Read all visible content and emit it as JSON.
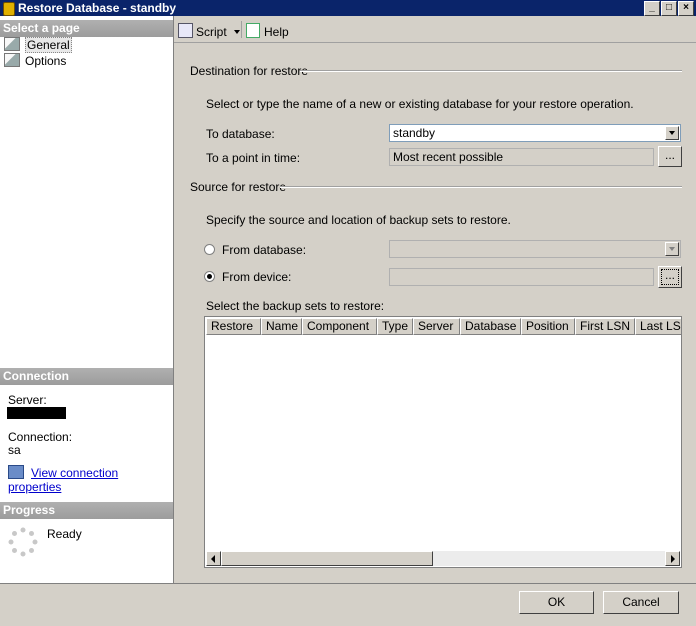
{
  "window": {
    "title": "Restore Database - standby"
  },
  "left": {
    "select_header": "Select a page",
    "pages": [
      {
        "label": "General"
      },
      {
        "label": "Options"
      }
    ],
    "connection_header": "Connection",
    "server_label": "Server:",
    "connection_label": "Connection:",
    "connection_value": "sa",
    "view_props": "View connection properties",
    "progress_header": "Progress",
    "progress_status": "Ready"
  },
  "toolbar": {
    "script": "Script",
    "help": "Help"
  },
  "destination": {
    "header": "Destination for restore",
    "instructions": "Select or type the name of a new or existing database for your restore operation.",
    "to_database_label": "To database:",
    "to_database_value": "standby",
    "point_in_time_label": "To a point in time:",
    "point_in_time_value": "Most recent possible",
    "browse_label": "..."
  },
  "source": {
    "header": "Source for restore",
    "instructions": "Specify the source and location of backup sets to restore.",
    "from_database_label": "From database:",
    "from_device_label": "From device:",
    "selected": "from_device",
    "browse_label": "...",
    "backup_sets_label": "Select the backup sets to restore:",
    "columns": [
      "Restore",
      "Name",
      "Component",
      "Type",
      "Server",
      "Database",
      "Position",
      "First LSN",
      "Last LSN"
    ]
  },
  "buttons": {
    "ok": "OK",
    "cancel": "Cancel"
  }
}
